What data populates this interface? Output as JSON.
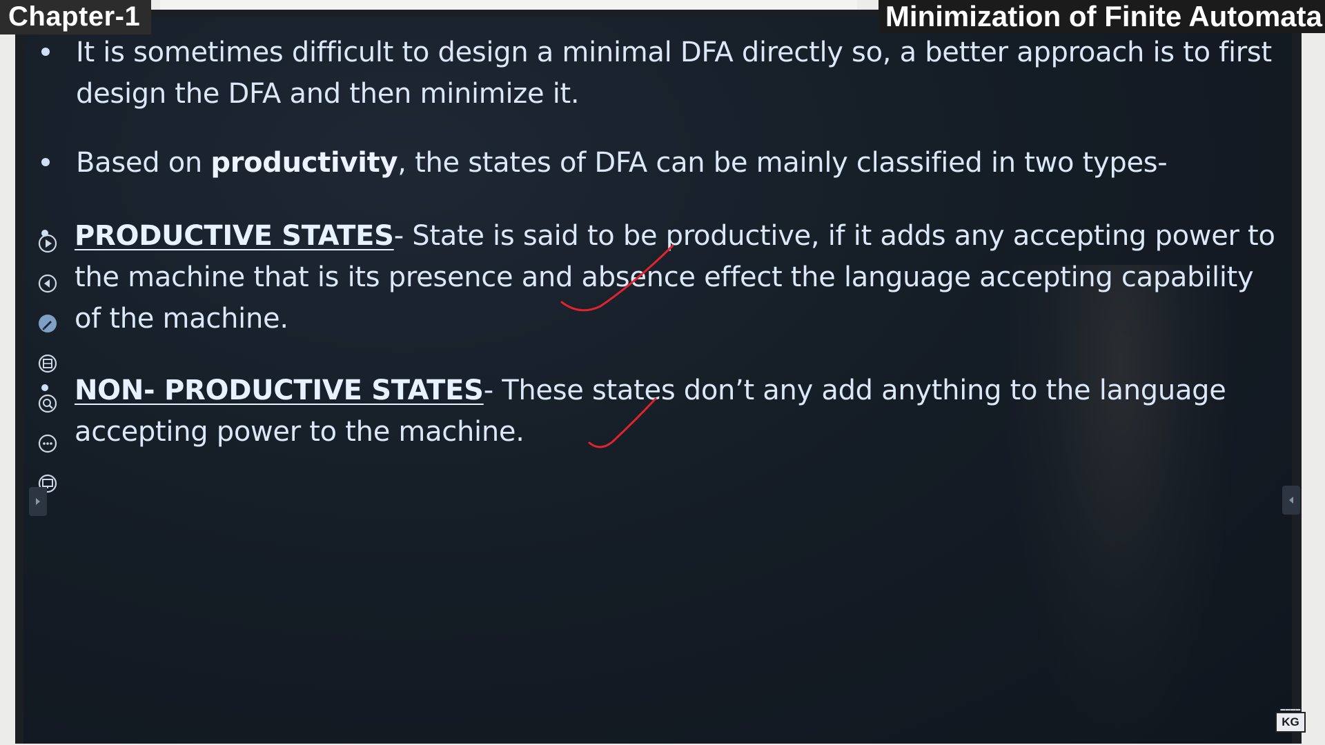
{
  "header": {
    "chapter": "Chapter-1",
    "topic": "Minimization of Finite Automata"
  },
  "slide": {
    "bullet1": {
      "line1": "It is sometimes difficult to design a minimal DFA directly so, a better approach is to first",
      "line2": "design the DFA and then minimize it."
    },
    "bullet2": {
      "prefix": "Based on ",
      "bold": "productivity",
      "suffix": ", the states of DFA can be mainly classified in two types-"
    },
    "productive": {
      "heading": "PRODUCTIVE STATES",
      "line1_rest": "- State is said to be productive, if it adds any accepting power to",
      "line2": "the machine that is its presence and absence effect the language accepting capability",
      "line3": "of the machine."
    },
    "non_productive": {
      "heading": "NON- PRODUCTIVE STATES",
      "line1_rest": "- These states don’t any add anything to the language",
      "line2": "accepting power to the machine."
    }
  },
  "toolbar": {
    "icons": [
      "play-icon",
      "back-icon",
      "pen-icon",
      "slides-icon",
      "zoom-icon",
      "more-icon",
      "screen-icon"
    ]
  },
  "logo": {
    "text": "KG"
  },
  "colors": {
    "screen_bg": "#151d26",
    "slide_text": "#dce8f7",
    "ink": "#e0242f",
    "header_bg": "#2c2c2c"
  }
}
